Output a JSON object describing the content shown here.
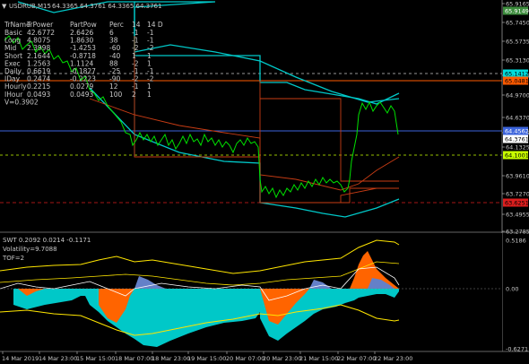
{
  "header": {
    "title": "USDRUB,M15",
    "ohlc": "64.3365 64.3761 64.3365 64.3761"
  },
  "table": {
    "columns": [
      "TrName",
      "TrPower",
      "PartPow",
      "Perc",
      "14",
      "14 D"
    ],
    "rows": [
      [
        "Basic",
        "42.6772",
        "2.6426",
        "6",
        "-1",
        "-1"
      ],
      [
        "Long",
        "4.8075",
        "1.8630",
        "38",
        "-1",
        "-1"
      ],
      [
        "Mid",
        "2.3998",
        "-1.4253",
        "-60",
        "-2",
        "-2"
      ],
      [
        "Short",
        "2.1644",
        "-0.8718",
        "-40",
        "1",
        "1"
      ],
      [
        "Exec",
        "1.2563",
        "1.1124",
        "88",
        "-2",
        "1"
      ],
      [
        "Daily",
        "0.6619",
        "-0.1827",
        "-25",
        "-1",
        "-1"
      ],
      [
        "IDay",
        "0.2474",
        "-0.2223",
        "-90",
        "-2",
        "-2"
      ],
      [
        "Hourly",
        "0.2215",
        "0.0279",
        "12",
        "-1",
        "1"
      ],
      [
        "IHour",
        "0.0493",
        "0.0493",
        "100",
        "2",
        "1"
      ]
    ],
    "v_line": "V=0.3902"
  },
  "price_axis": {
    "ticks": [
      "65.9165",
      "65.7450",
      "65.5735",
      "65.3130",
      "65.1415",
      "64.9700",
      "64.6370",
      "64.4655",
      "64.1325",
      "63.9610",
      "63.7270",
      "63.4955",
      "63.2785"
    ],
    "labels": [
      {
        "text": "65.9149",
        "bg": "#3c8c3c",
        "color": "#ffffff"
      },
      {
        "text": "65.1412",
        "bg": "#00dcdc",
        "color": "#000000"
      },
      {
        "text": "65.0481",
        "bg": "#ff5a00",
        "color": "#000000"
      },
      {
        "text": "64.4562",
        "bg": "#3c64dc",
        "color": "#ffffff"
      },
      {
        "text": "64.3761",
        "bg": "#ffffff",
        "color": "#000000"
      },
      {
        "text": "64.1001",
        "bg": "#c8ff00",
        "color": "#000000"
      },
      {
        "text": "63.6251",
        "bg": "#dc1e1e",
        "color": "#000000"
      }
    ]
  },
  "indicator": {
    "line1": "SWT 0.2092 0.0214 -0.1171",
    "line2": "Volatility=9.7088",
    "line3": "TOF=2",
    "axis_ticks": [
      "0.5186",
      "0.00",
      "-0.6271"
    ]
  },
  "time_axis": [
    "14 Mar 2019",
    "14 Mar 23:00",
    "15 Mar 15:00",
    "18 Mar 07:00",
    "18 Mar 23:00",
    "19 Mar 15:00",
    "20 Mar 07:00",
    "20 Mar 23:00",
    "21 Mar 15:00",
    "22 Mar 07:00",
    "22 Mar 23:00"
  ],
  "colors": {
    "price": "#00e000",
    "channel": "#00c8c8",
    "levels": "#c83c14",
    "grid_dash": "#505050"
  }
}
